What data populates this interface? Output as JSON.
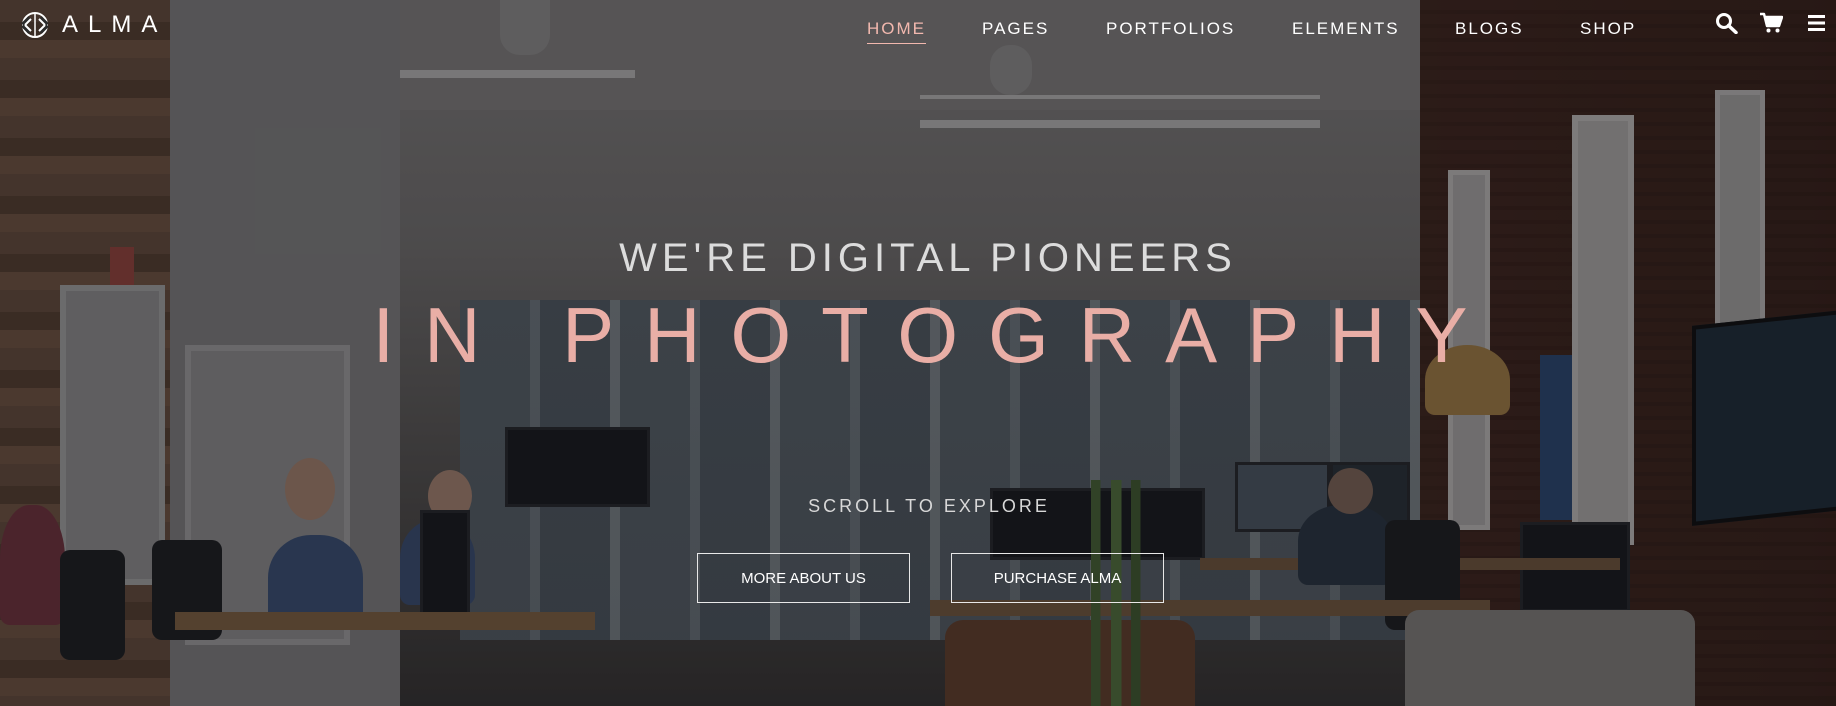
{
  "brand": {
    "name": "ALMA"
  },
  "nav": {
    "items": [
      {
        "label": "HOME",
        "active": true
      },
      {
        "label": "PAGES",
        "active": false
      },
      {
        "label": "PORTFOLIOS",
        "active": false
      },
      {
        "label": "ELEMENTS",
        "active": false
      },
      {
        "label": "BLOGS",
        "active": false
      },
      {
        "label": "SHOP",
        "active": false
      }
    ]
  },
  "toolbar": {
    "icons": [
      "search-icon",
      "cart-icon",
      "menu-icon"
    ]
  },
  "hero": {
    "headline_small": "WE'RE DIGITAL PIONEERS",
    "headline_big": "IN PHOTOGRAPHY",
    "scroll_text": "SCROLL TO EXPLORE",
    "primary_button": "MORE ABOUT US",
    "secondary_button": "PURCHASE ALMA"
  },
  "colors": {
    "accent": "#e9aea6",
    "active_nav": "#f2b8ae",
    "text": "#ffffff"
  }
}
